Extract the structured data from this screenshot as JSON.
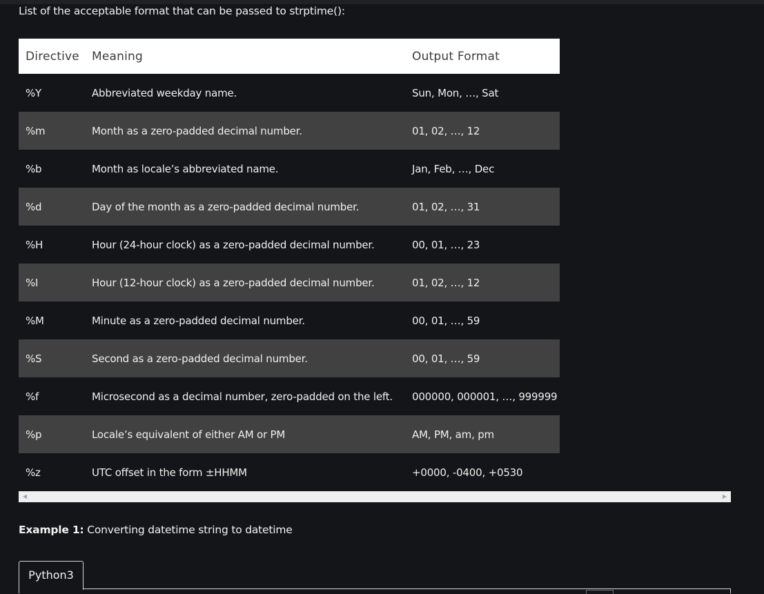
{
  "intro": "List of the acceptable format that can be passed to strptime():",
  "table": {
    "headers": [
      "Directive",
      "Meaning",
      "Output Format"
    ],
    "rows": [
      [
        "%Y",
        "Abbreviated weekday name.",
        "Sun, Mon, …, Sat"
      ],
      [
        "%m",
        "Month as a zero-padded decimal number.",
        "01, 02, …, 12"
      ],
      [
        "%b",
        "Month as locale’s abbreviated name.",
        "Jan, Feb, …, Dec"
      ],
      [
        "%d",
        "Day of the month as a zero-padded decimal number.",
        "01, 02, …, 31"
      ],
      [
        "%H",
        "Hour (24-hour clock) as a zero-padded decimal number.",
        "00, 01, …, 23"
      ],
      [
        "%I",
        "Hour (12-hour clock) as a zero-padded decimal number.",
        "01, 02, …, 12"
      ],
      [
        "%M",
        "Minute as a zero-padded decimal number.",
        "00, 01, …, 59"
      ],
      [
        "%S",
        "Second as a zero-padded decimal number.",
        "00, 01, …, 59"
      ],
      [
        "%f",
        "Microsecond as a decimal number, zero-padded on the left.",
        "000000, 000001, …, 999999"
      ],
      [
        "%p",
        "Locale’s equivalent of either AM or PM",
        "AM, PM, am, pm"
      ],
      [
        "%z",
        "UTC offset in the form ±HHMM",
        "+0000, -0400, +0530"
      ]
    ]
  },
  "scrollbar": {
    "left_arrow_icon": "triangle-left-icon",
    "right_arrow_icon": "triangle-right-icon"
  },
  "example": {
    "label": "Example 1:",
    "text": " Converting datetime string to datetime"
  },
  "code_tab": {
    "label": "Python3"
  },
  "colors": {
    "background": "#141518",
    "header_bg": "#ffffff",
    "row_alt": "#414141"
  }
}
